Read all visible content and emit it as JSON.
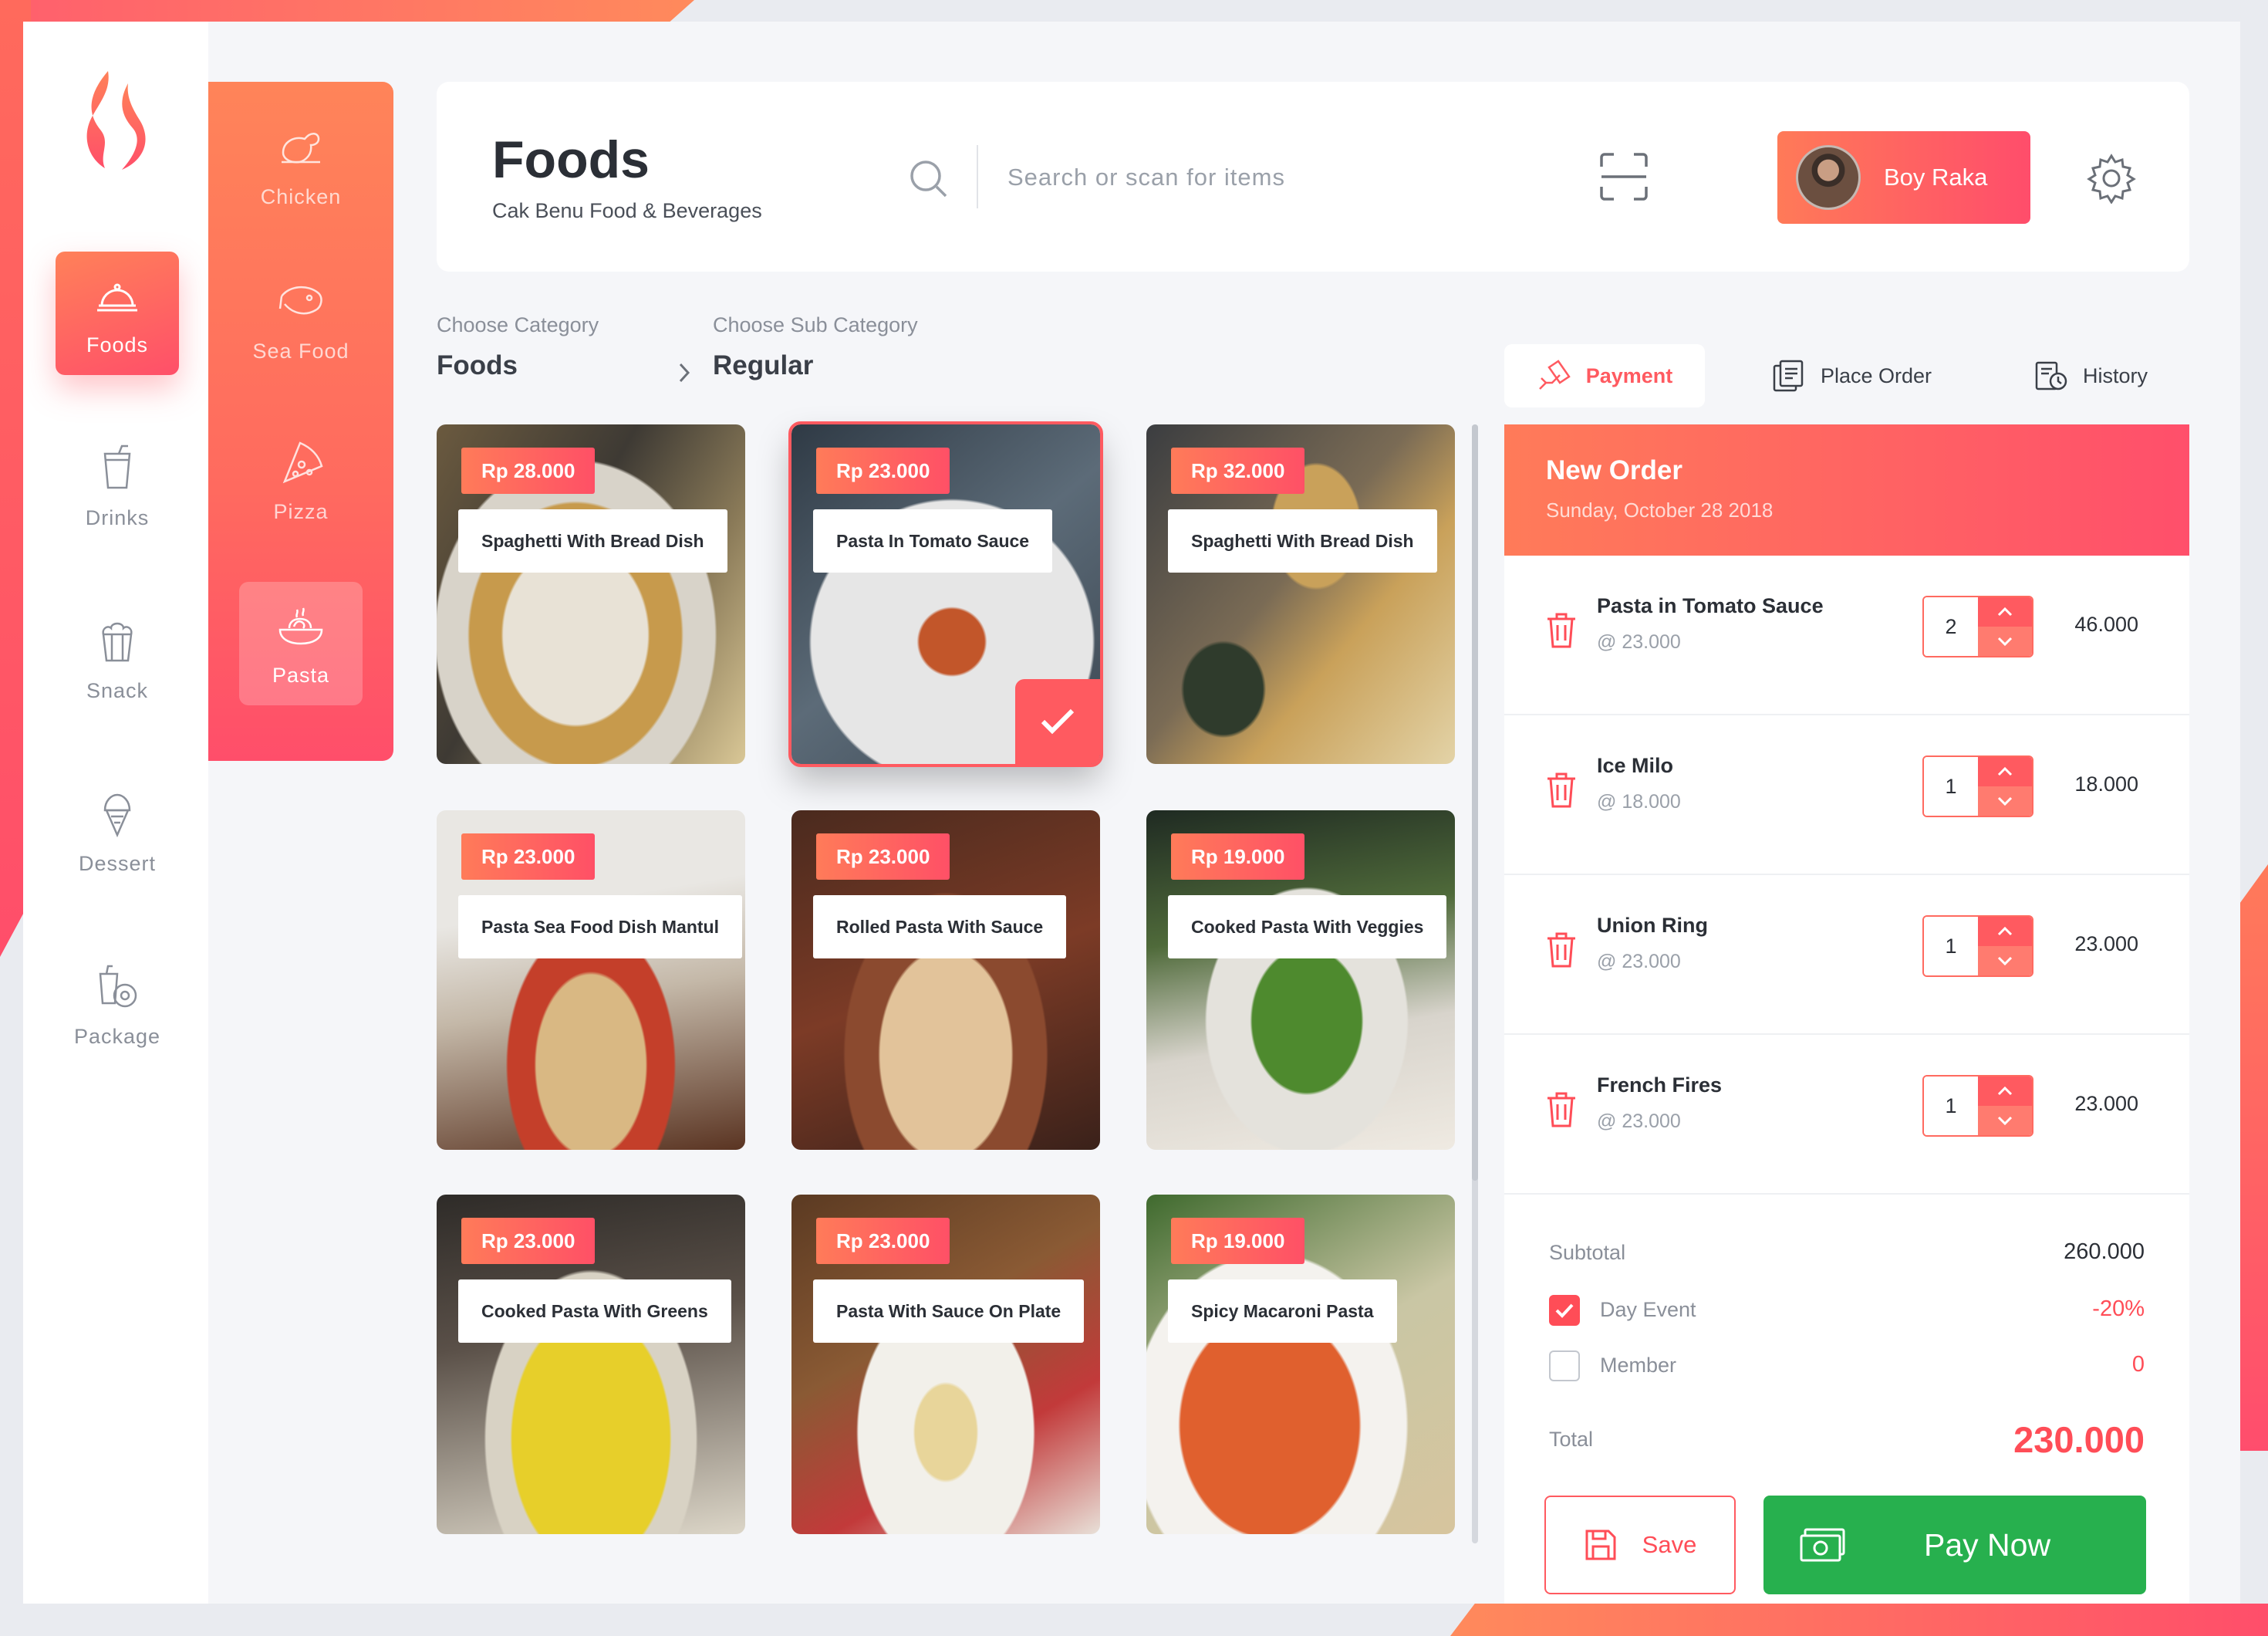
{
  "nav": {
    "items": [
      {
        "label": "Foods",
        "icon": "cloche-icon"
      },
      {
        "label": "Drinks",
        "icon": "cup-icon"
      },
      {
        "label": "Snack",
        "icon": "popcorn-icon"
      },
      {
        "label": "Dessert",
        "icon": "ice-cream-icon"
      },
      {
        "label": "Package",
        "icon": "combo-icon"
      }
    ]
  },
  "subnav": {
    "items": [
      {
        "label": "Chicken",
        "icon": "chicken-icon"
      },
      {
        "label": "Sea Food",
        "icon": "fish-icon"
      },
      {
        "label": "Pizza",
        "icon": "pizza-icon"
      },
      {
        "label": "Pasta",
        "icon": "pasta-icon"
      }
    ]
  },
  "header": {
    "title": "Foods",
    "subtitle": "Cak Benu Food & Beverages",
    "search_placeholder": "Search or scan for items",
    "user_name": "Boy Raka"
  },
  "breadcrumb": {
    "category_label": "Choose Category",
    "category_value": "Foods",
    "sub_label": "Choose Sub Category",
    "sub_value": "Regular"
  },
  "tabs": [
    {
      "label": "Payment",
      "icon": "hand-card-icon"
    },
    {
      "label": "Place Order",
      "icon": "receipt-icon"
    },
    {
      "label": "History",
      "icon": "history-icon"
    }
  ],
  "products": [
    {
      "price": "Rp 28.000",
      "name": "Spaghetti With Bread Dish"
    },
    {
      "price": "Rp 23.000",
      "name": "Pasta In Tomato Sauce"
    },
    {
      "price": "Rp 32.000",
      "name": "Spaghetti With Bread Dish"
    },
    {
      "price": "Rp 23.000",
      "name": "Pasta Sea Food Dish Mantul"
    },
    {
      "price": "Rp 23.000",
      "name": "Rolled Pasta With Sauce"
    },
    {
      "price": "Rp 19.000",
      "name": "Cooked Pasta With Veggies"
    },
    {
      "price": "Rp 23.000",
      "name": "Cooked Pasta With Greens"
    },
    {
      "price": "Rp 23.000",
      "name": "Pasta With Sauce On Plate"
    },
    {
      "price": "Rp 19.000",
      "name": "Spicy Macaroni Pasta"
    }
  ],
  "order": {
    "title": "New Order",
    "date": "Sunday, October 28 2018",
    "items": [
      {
        "name": "Pasta in Tomato Sauce",
        "unit": "@ 23.000",
        "qty": "2",
        "total": "46.000"
      },
      {
        "name": "Ice Milo",
        "unit": "@ 18.000",
        "qty": "1",
        "total": "18.000"
      },
      {
        "name": "Union Ring",
        "unit": "@ 23.000",
        "qty": "1",
        "total": "23.000"
      },
      {
        "name": "French Fires",
        "unit": "@ 23.000",
        "qty": "1",
        "total": "23.000"
      }
    ],
    "subtotal_label": "Subtotal",
    "subtotal_value": "260.000",
    "day_event_label": "Day Event",
    "day_event_value": "-20%",
    "member_label": "Member",
    "member_value": "0",
    "total_label": "Total",
    "total_value": "230.000",
    "save_label": "Save",
    "pay_label": "Pay Now"
  },
  "colors": {
    "accent": "#ff5a60",
    "gradient_start": "#ff8159",
    "gradient_end": "#ff4f69",
    "pay_green": "#27b04e"
  }
}
